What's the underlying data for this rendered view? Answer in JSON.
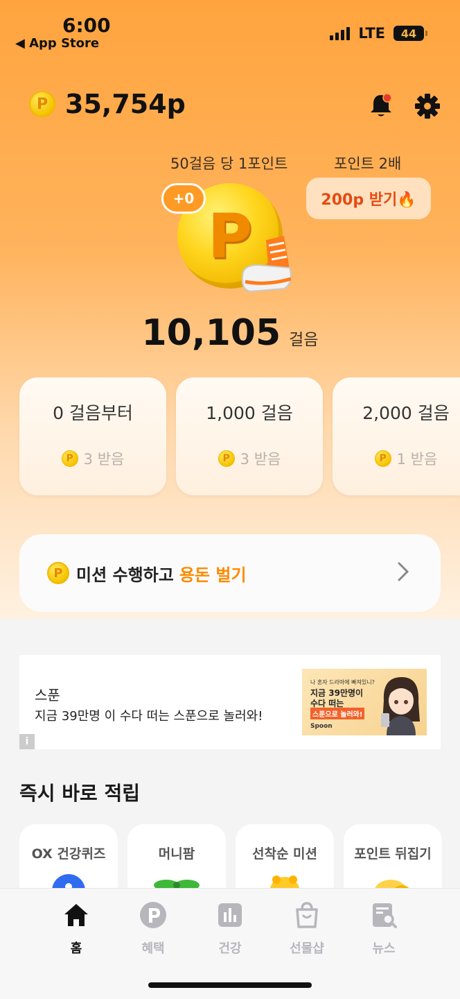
{
  "status_bar": {
    "time": "6:00",
    "back": "◀ App Store",
    "network": "LTE",
    "battery": "44"
  },
  "header": {
    "total_points": "35,754p",
    "coin_letter": "P"
  },
  "walk": {
    "rate_label": "50걸음 당 1포인트",
    "double_label": "포인트 2배",
    "double_button": "200p 받기🔥",
    "plus_badge": "+0",
    "coin_letter": "P",
    "steps": "10,105",
    "steps_unit": "걸음"
  },
  "milestones": [
    {
      "title": "0 걸음부터",
      "reward": "3 받음"
    },
    {
      "title": "1,000 걸음",
      "reward": "3 받음"
    },
    {
      "title": "2,000 걸음",
      "reward": "1 받음"
    }
  ],
  "mission": {
    "text": "미션 수행하고",
    "highlight": "용돈 벌기"
  },
  "ad": {
    "title": "스푼",
    "desc": "지금 39만명 이 수다 떠는 스푼으로 놀러와!",
    "info": "i",
    "img_line1": "나 혼자 드라마에 빠져있니?",
    "img_line2": "지금 39만명이",
    "img_line3": "수다 떠는",
    "img_line4": "스푼으로 놀러와!",
    "img_brand": "Spoon"
  },
  "instant": {
    "title": "즉시 바로 적립",
    "cards": [
      "OX 건강퀴즈",
      "머니팜",
      "선착순 미션",
      "포인트 뒤집기"
    ]
  },
  "tabs": [
    {
      "label": "홈",
      "icon": "home-icon"
    },
    {
      "label": "혜택",
      "icon": "benefit-p-icon"
    },
    {
      "label": "건강",
      "icon": "chart-icon"
    },
    {
      "label": "선물샵",
      "icon": "shopping-bag-icon"
    },
    {
      "label": "뉴스",
      "icon": "news-search-icon"
    }
  ],
  "colors": {
    "accent": "#ff8a00",
    "primary_bg": "#ffa43f",
    "coin": "#f5c400",
    "fire_button": "#e44b12"
  }
}
